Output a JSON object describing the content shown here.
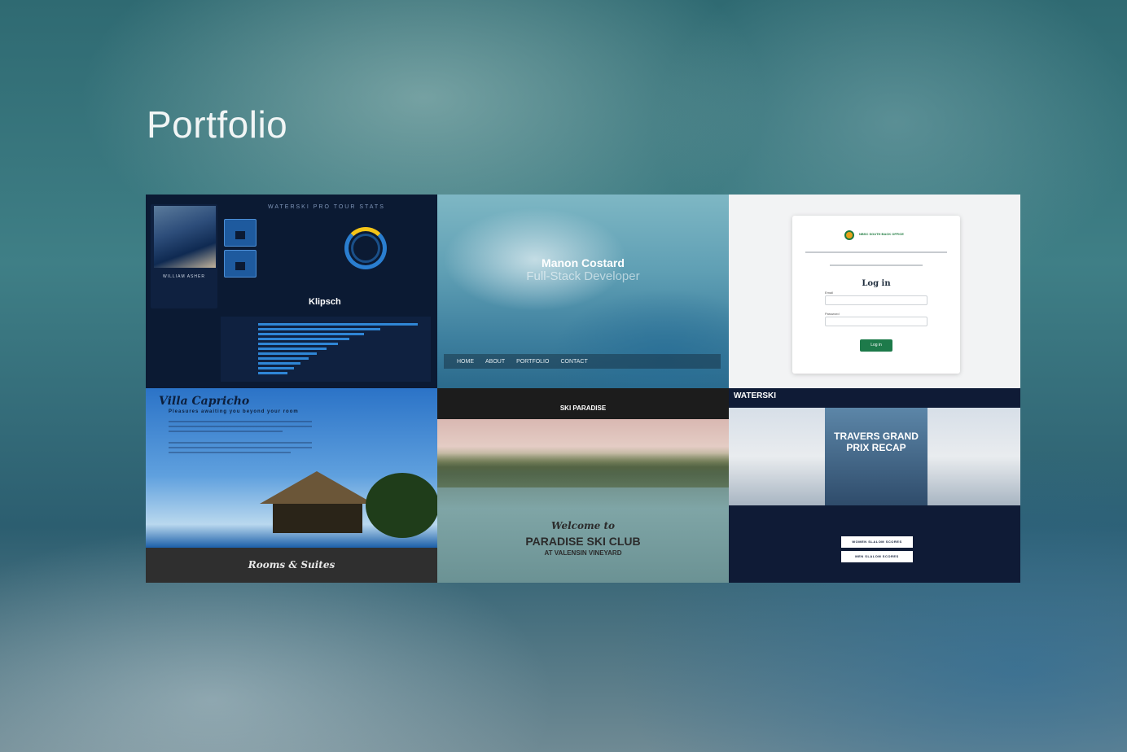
{
  "page": {
    "title": "Portfolio"
  },
  "tiles": [
    {
      "id": "stats-dashboard",
      "header": "WATERSKI PRO TOUR STATS",
      "athlete": "WILLIAM ASHER",
      "brand": "Klipsch"
    },
    {
      "id": "personal-site",
      "name": "Manon Costard",
      "role": "Full-Stack Developer",
      "nav": [
        "HOME",
        "ABOUT",
        "PORTFOLIO",
        "CONTACT"
      ]
    },
    {
      "id": "login-page",
      "brand": "NBSC SOUTH BACK OFFICE",
      "heading": "Log in",
      "email_label": "Email",
      "password_label": "Password",
      "button": "Log in"
    },
    {
      "id": "villa-capricho",
      "title": "Villa Capricho",
      "tagline": "Pleasures awaiting you beyond your room",
      "footer": "Rooms & Suites"
    },
    {
      "id": "ski-paradise",
      "logo": "SKI PARADISE",
      "welcome": "Welcome to",
      "club": "PARADISE SKI CLUB",
      "subtitle": "AT VALENSIN VINEYARD"
    },
    {
      "id": "waterski-tour",
      "brand": "WATERSKI",
      "feature": "TRAVERS GRAND PRIX RECAP",
      "buttons": [
        "WOMEN SLALOM SCORES",
        "MEN SLALOM SCORES"
      ]
    }
  ],
  "colors": {
    "accent_blue": "#2f86d6",
    "login_green": "#1d7a4a"
  }
}
